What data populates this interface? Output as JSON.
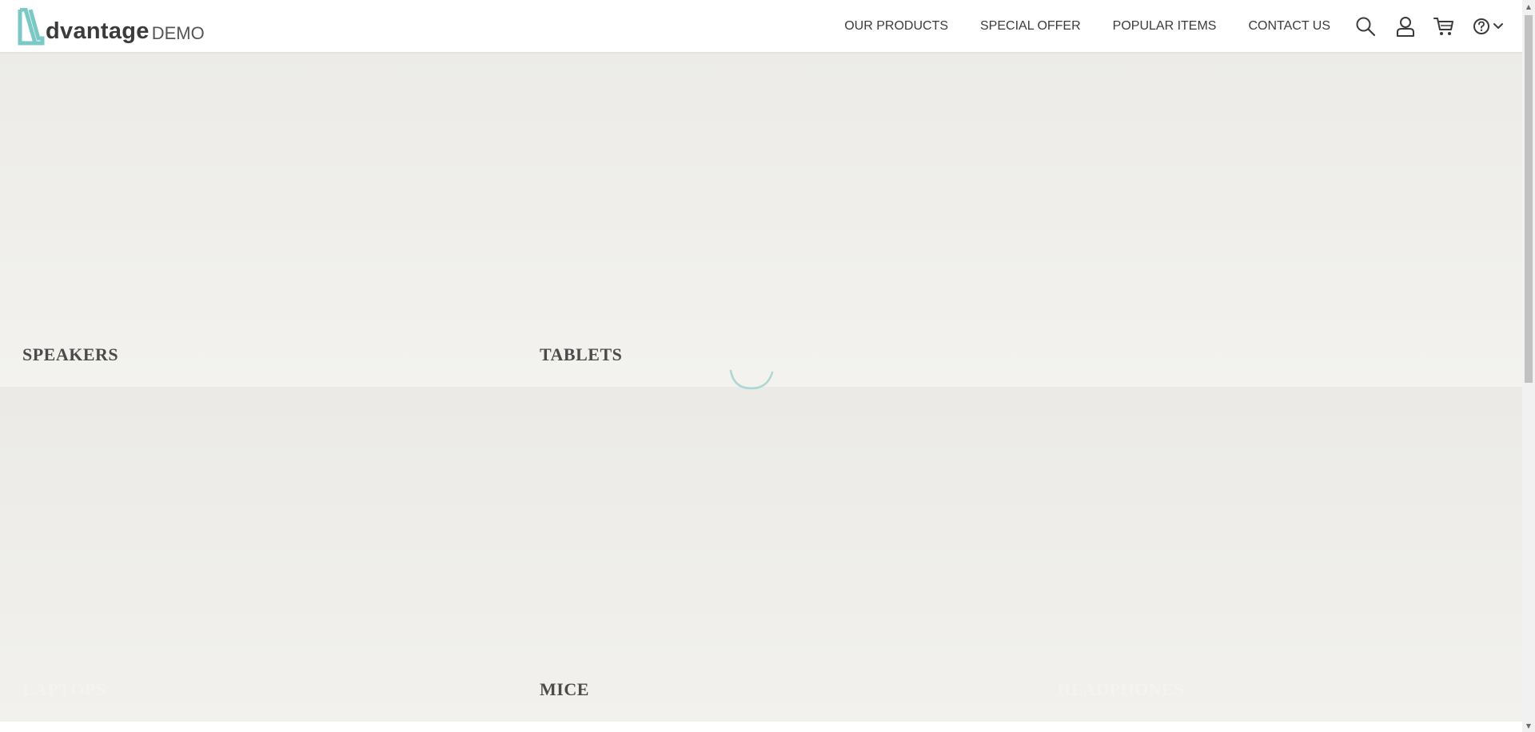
{
  "brand": {
    "name": "dvantage",
    "suffix": "DEMO",
    "accent_color": "#7ac9c4"
  },
  "nav": {
    "items": [
      {
        "label": "OUR PRODUCTS"
      },
      {
        "label": "SPECIAL OFFER"
      },
      {
        "label": "POPULAR ITEMS"
      },
      {
        "label": "CONTACT US"
      }
    ]
  },
  "header_icons": [
    "search-icon",
    "user-icon",
    "cart-icon",
    "help-icon",
    "chevron-down-icon"
  ],
  "categories": {
    "row1": [
      {
        "label": "SPEAKERS"
      },
      {
        "label": "TABLETS"
      }
    ],
    "row2": [
      {
        "label": "LAPTOPS"
      },
      {
        "label": "MICE"
      },
      {
        "label": "HEADPHONES"
      }
    ]
  },
  "colors": {
    "label_dark": "#4b4b4b",
    "label_light": "#f4f3ef",
    "loader": "#9fd3cf"
  }
}
